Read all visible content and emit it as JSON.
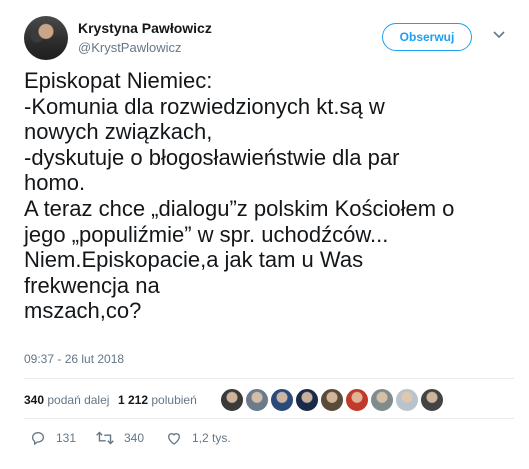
{
  "user": {
    "name": "Krystyna Pawłowicz",
    "handle": "@KrystPawlowicz",
    "follow_label": "Obserwuj"
  },
  "tweet": {
    "lines": [
      "Episkopat Niemiec:",
      "-Komunia dla rozwiedzionych kt.są w",
      "nowych związkach,",
      "-dyskutuje o błogosławieństwie dla par",
      "homo.",
      "A teraz chce „dialogu”z polskim Kościołem o",
      "jego „populiźmie” w spr. uchodźców...",
      "Niem.Episkopacie,a jak tam u Was",
      "frekwencja na",
      "mszach,co?"
    ],
    "timestamp": "09:37 - 26 lut 2018"
  },
  "stats": {
    "retweets_count": "340",
    "retweets_label": "podań dalej",
    "likes_count": "1 212",
    "likes_label": "polubień"
  },
  "liker_avatars": [
    {
      "name": "liker-avatar-1",
      "color": "#3a3a3a"
    },
    {
      "name": "liker-avatar-2",
      "color": "#6b7b8c"
    },
    {
      "name": "liker-avatar-3",
      "color": "#2b4a7a"
    },
    {
      "name": "liker-avatar-4",
      "color": "#1a2a4a"
    },
    {
      "name": "liker-avatar-5",
      "color": "#5a4a3a"
    },
    {
      "name": "liker-avatar-6",
      "color": "#c0392b"
    },
    {
      "name": "liker-avatar-7",
      "color": "#7f8c8d"
    },
    {
      "name": "liker-avatar-8",
      "color": "#b8c4cc"
    },
    {
      "name": "liker-avatar-9",
      "color": "#444444"
    }
  ],
  "actions": {
    "reply_count": "131",
    "retweet_count": "340",
    "like_count": "1,2 tys."
  },
  "colors": {
    "accent": "#1da1f2",
    "text": "#14171a",
    "muted": "#657786"
  }
}
